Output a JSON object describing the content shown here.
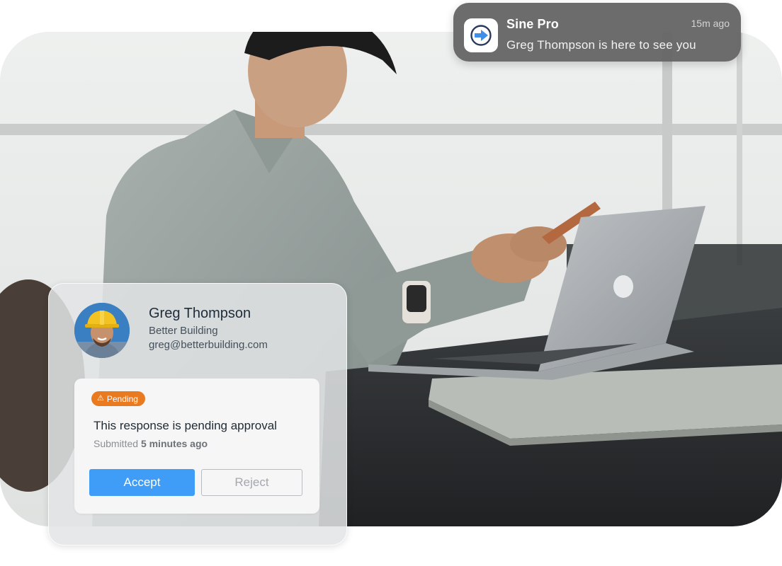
{
  "notification": {
    "app_name": "Sine Pro",
    "time": "15m ago",
    "message": "Greg Thompson is here to see you",
    "icon": "arrow-right-circle-icon"
  },
  "visitor": {
    "name": "Greg Thompson",
    "company": "Better Building",
    "email": "greg@betterbuilding.com",
    "avatar": "construction-worker-avatar"
  },
  "approval": {
    "badge": "Pending",
    "badge_icon": "warning-icon",
    "title": "This response is pending approval",
    "submitted_prefix": "Submitted",
    "submitted_time": "5 minutes ago",
    "accept_label": "Accept",
    "reject_label": "Reject"
  },
  "colors": {
    "accent": "#3f9cf7",
    "pending": "#ea7a1f",
    "notification_bg": "#666666"
  }
}
